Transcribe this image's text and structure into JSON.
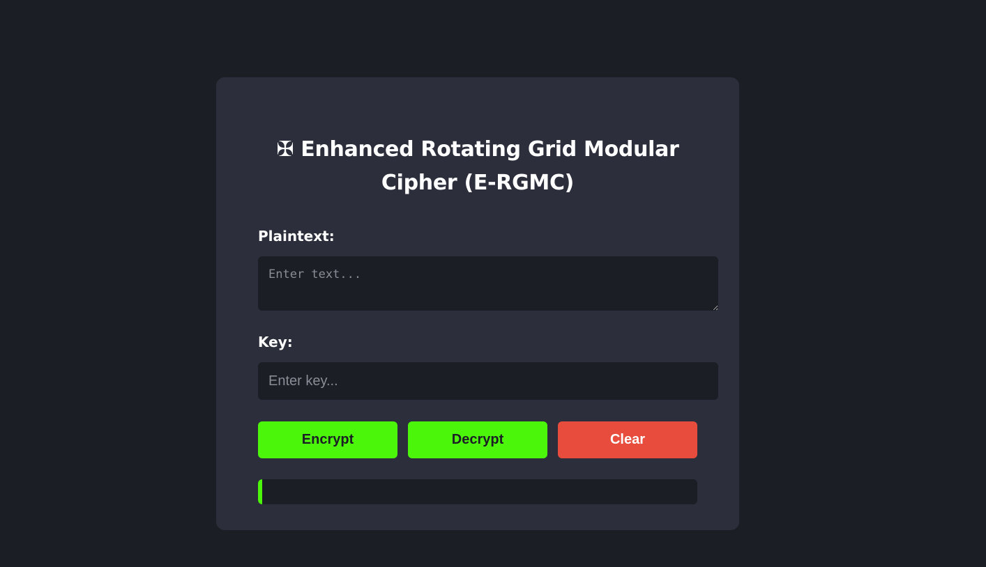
{
  "title": {
    "icon_glyph": "✠",
    "icon": "maltese-cross-icon",
    "text": "Enhanced Rotating Grid Modular Cipher (E-RGMC)"
  },
  "plaintext": {
    "label": "Plaintext:",
    "value": "",
    "placeholder": "Enter text..."
  },
  "key": {
    "label": "Key:",
    "value": "",
    "placeholder": "Enter key..."
  },
  "buttons": {
    "encrypt_label": "Encrypt",
    "decrypt_label": "Decrypt",
    "clear_label": "Clear"
  },
  "progress": {
    "fraction": 0.01
  },
  "colors": {
    "background": "#1c1e25",
    "card": "#2c2f3b",
    "accent_green": "#4cf60a",
    "danger_red": "#e84c3d"
  }
}
